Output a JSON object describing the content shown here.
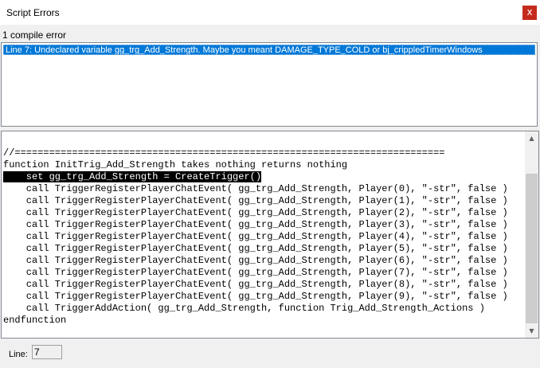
{
  "window": {
    "title": "Script Errors",
    "close_glyph": "x"
  },
  "errors": {
    "count_label": "1 compile error",
    "items": [
      "Line 7: Undeclared variable gg_trg_Add_Strength. Maybe you meant DAMAGE_TYPE_COLD or bj_crippledTimerWindows"
    ]
  },
  "code": {
    "highlighted_line": 3,
    "lines": [
      "//===========================================================================",
      "function InitTrig_Add_Strength takes nothing returns nothing",
      "    set gg_trg_Add_Strength = CreateTrigger()",
      "    call TriggerRegisterPlayerChatEvent( gg_trg_Add_Strength, Player(0), \"-str\", false )",
      "    call TriggerRegisterPlayerChatEvent( gg_trg_Add_Strength, Player(1), \"-str\", false )",
      "    call TriggerRegisterPlayerChatEvent( gg_trg_Add_Strength, Player(2), \"-str\", false )",
      "    call TriggerRegisterPlayerChatEvent( gg_trg_Add_Strength, Player(3), \"-str\", false )",
      "    call TriggerRegisterPlayerChatEvent( gg_trg_Add_Strength, Player(4), \"-str\", false )",
      "    call TriggerRegisterPlayerChatEvent( gg_trg_Add_Strength, Player(5), \"-str\", false )",
      "    call TriggerRegisterPlayerChatEvent( gg_trg_Add_Strength, Player(6), \"-str\", false )",
      "    call TriggerRegisterPlayerChatEvent( gg_trg_Add_Strength, Player(7), \"-str\", false )",
      "    call TriggerRegisterPlayerChatEvent( gg_trg_Add_Strength, Player(8), \"-str\", false )",
      "    call TriggerRegisterPlayerChatEvent( gg_trg_Add_Strength, Player(9), \"-str\", false )",
      "    call TriggerAddAction( gg_trg_Add_Strength, function Trig_Add_Strength_Actions )",
      "endfunction"
    ]
  },
  "status": {
    "line_label": "Line:",
    "line_value": "7"
  },
  "icons": {
    "close": "close-icon",
    "scroll_up": "scroll-up-icon",
    "scroll_down": "scroll-down-icon"
  },
  "colors": {
    "selection": "#0078d7",
    "close_button": "#c42b1c"
  }
}
